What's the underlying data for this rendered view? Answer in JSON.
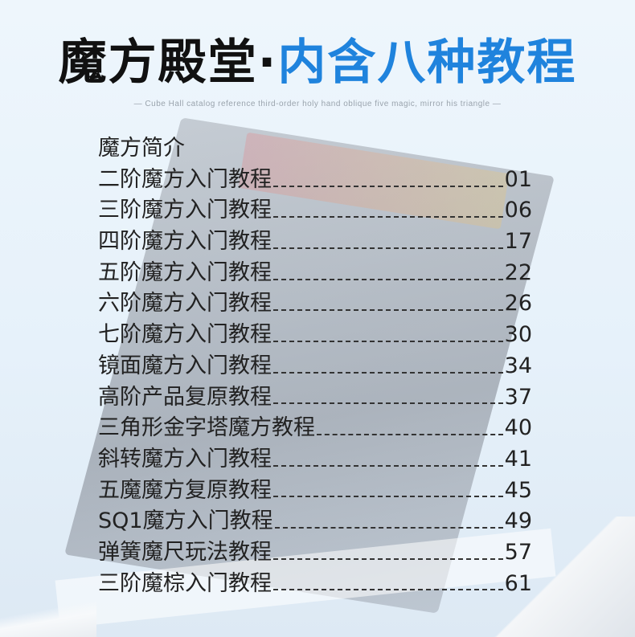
{
  "header": {
    "title_part1": "魔方殿堂",
    "title_dot": "·",
    "title_part2": "内含八种教程",
    "subtitle": "— Cube Hall catalog reference third-order holy hand oblique five magic, mirror his triangle —"
  },
  "toc": {
    "intro": "魔方简介",
    "entries": [
      {
        "label": "二阶魔方入门教程",
        "page": "01"
      },
      {
        "label": "三阶魔方入门教程",
        "page": "06"
      },
      {
        "label": "四阶魔方入门教程",
        "page": "17"
      },
      {
        "label": "五阶魔方入门教程",
        "page": "22"
      },
      {
        "label": "六阶魔方入门教程",
        "page": "26"
      },
      {
        "label": "七阶魔方入门教程",
        "page": "30"
      },
      {
        "label": "镜面魔方入门教程",
        "page": "34"
      },
      {
        "label": "高阶产品复原教程",
        "page": "37"
      },
      {
        "label": "三角形金字塔魔方教程",
        "page": "40"
      },
      {
        "label": "斜转魔方入门教程",
        "page": "41"
      },
      {
        "label": "五魔魔方复原教程",
        "page": "45"
      },
      {
        "label": "SQ1魔方入门教程",
        "page": "49"
      },
      {
        "label": "弹簧魔尺玩法教程",
        "page": "57"
      },
      {
        "label": "三阶魔棕入门教程",
        "page": "61"
      }
    ]
  },
  "colors": {
    "accent": "#1f83dd",
    "title_dark": "#111111",
    "text": "#222222"
  }
}
